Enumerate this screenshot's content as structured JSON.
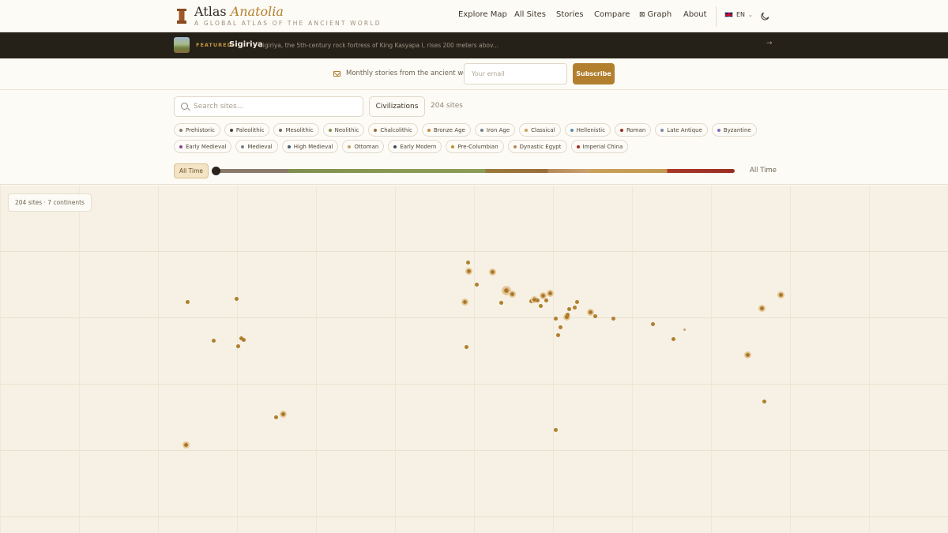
{
  "header": {
    "brand_main": "Atlas",
    "brand_accent": "Anatolia",
    "tagline": "A GLOBAL ATLAS OF THE ANCIENT WORLD",
    "nav": {
      "explore": "Explore Map",
      "all_sites": "All Sites",
      "stories": "Stories",
      "compare": "Compare",
      "graph": "Graph",
      "about": "About"
    },
    "language": "EN",
    "icons": [
      "column-icon",
      "graph-icon",
      "flag-icon",
      "chevron-down-icon",
      "moon-icon"
    ]
  },
  "featured": {
    "label": "FEATURED",
    "title": "Sigiriya",
    "description": "Sigiriya, the 5th-century rock fortress of King Kasyapa I, rises 200 meters abov...",
    "arrow": "→"
  },
  "newsletter": {
    "text": "Monthly stories from the ancient world",
    "email_placeholder": "Your email",
    "subscribe_label": "Subscribe"
  },
  "filters": {
    "search_placeholder": "Search sites...",
    "civilizations_label": "Civilizations",
    "site_count": "204 sites",
    "periods_row1": [
      {
        "label": "Prehistoric",
        "color": "#8a7a6a"
      },
      {
        "label": "Paleolithic",
        "color": "#4a4236"
      },
      {
        "label": "Mesolithic",
        "color": "#6e6a5a"
      },
      {
        "label": "Neolithic",
        "color": "#7f8f4e"
      },
      {
        "label": "Chalcolithic",
        "color": "#9a6d3a"
      },
      {
        "label": "Bronze Age",
        "color": "#c08a3e"
      },
      {
        "label": "Iron Age",
        "color": "#6f7f8f"
      },
      {
        "label": "Classical",
        "color": "#caa058"
      },
      {
        "label": "Hellenistic",
        "color": "#5a8fb0"
      },
      {
        "label": "Roman",
        "color": "#9a2e22"
      },
      {
        "label": "Late Antique",
        "color": "#7a8ab0"
      },
      {
        "label": "Byzantine",
        "color": "#7b6fc0"
      }
    ],
    "periods_row2": [
      {
        "label": "Early Medieval",
        "color": "#8a3f9a"
      },
      {
        "label": "Medieval",
        "color": "#7a7f8a"
      },
      {
        "label": "High Medieval",
        "color": "#3f5a7a"
      },
      {
        "label": "Ottoman",
        "color": "#c0a06e"
      },
      {
        "label": "Early Modern",
        "color": "#3f4a5a"
      },
      {
        "label": "Pre-Columbian",
        "color": "#c0902e"
      },
      {
        "label": "Dynastic Egypt",
        "color": "#b58a5a"
      },
      {
        "label": "Imperial China",
        "color": "#a8281e"
      }
    ],
    "timeline_start_label": "All Time",
    "timeline_end_label": "All Time"
  },
  "map": {
    "badge": "204 sites · 7 continents"
  }
}
